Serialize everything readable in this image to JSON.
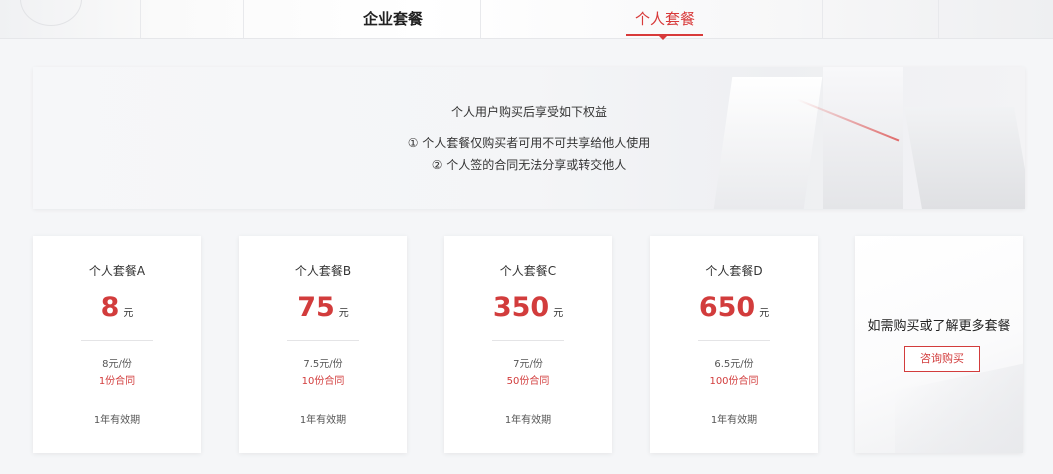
{
  "tabs": {
    "enterprise_label": "企业套餐",
    "personal_label": "个人套餐"
  },
  "benefits": {
    "title": "个人用户购买后享受如下权益",
    "line1": "① 个人套餐仅购买者可用不可共享给他人使用",
    "line2": "② 个人签的合同无法分享或转交他人"
  },
  "plans": [
    {
      "name": "个人套餐A",
      "price": "8",
      "unit": "元",
      "per_copy": "8元/份",
      "count": "1份合同",
      "validity": "1年有效期"
    },
    {
      "name": "个人套餐B",
      "price": "75",
      "unit": "元",
      "per_copy": "7.5元/份",
      "count": "10份合同",
      "validity": "1年有效期"
    },
    {
      "name": "个人套餐C",
      "price": "350",
      "unit": "元",
      "per_copy": "7元/份",
      "count": "50份合同",
      "validity": "1年有效期"
    },
    {
      "name": "个人套餐D",
      "price": "650",
      "unit": "元",
      "per_copy": "6.5元/份",
      "count": "100份合同",
      "validity": "1年有效期"
    }
  ],
  "more": {
    "text": "如需购买或了解更多套餐",
    "button_label": "咨询购买"
  },
  "colors": {
    "accent": "#d23c3c",
    "background": "#f5f6f8"
  }
}
